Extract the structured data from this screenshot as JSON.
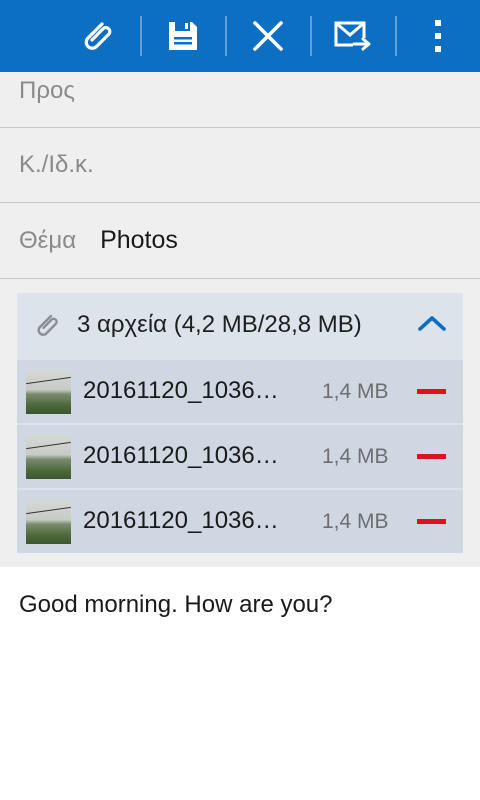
{
  "toolbar": {
    "actions": [
      {
        "name": "attach",
        "icon": "paperclip-icon"
      },
      {
        "name": "save",
        "icon": "save-icon"
      },
      {
        "name": "discard",
        "icon": "close-icon"
      },
      {
        "name": "send",
        "icon": "send-mail-icon"
      },
      {
        "name": "more",
        "icon": "more-vert-icon"
      }
    ],
    "color": "#0d6fc1"
  },
  "fields": {
    "to_label": "Προς",
    "ccbcc_label": "Κ./Ιδ.κ.",
    "subject_label": "Θέμα",
    "subject_value": "Photos"
  },
  "attachments": {
    "summary": "3 αρχεία (4,2 MB/28,8 MB)",
    "items": [
      {
        "name": "20161120_1036…",
        "size": "1,4 MB"
      },
      {
        "name": "20161120_1036…",
        "size": "1,4 MB"
      },
      {
        "name": "20161120_1036…",
        "size": "1,4 MB"
      }
    ]
  },
  "body": {
    "text": "Good morning. How are you?"
  }
}
